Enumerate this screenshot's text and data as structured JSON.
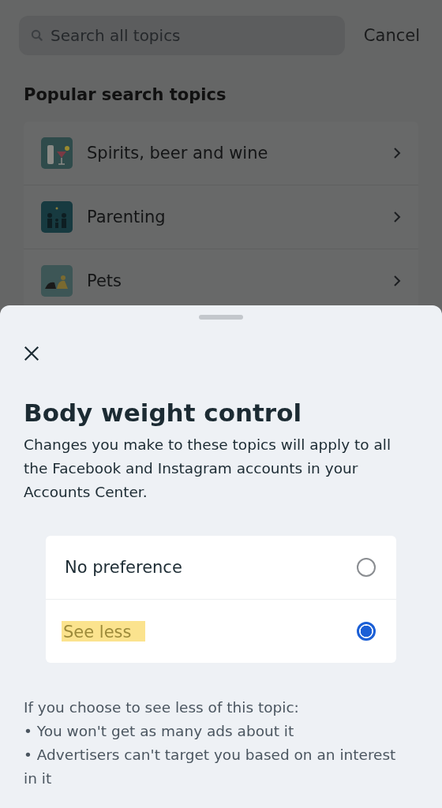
{
  "search": {
    "placeholder": "Search all topics",
    "cancel": "Cancel"
  },
  "section_title": "Popular search topics",
  "topics": [
    {
      "label": "Spirits, beer and wine",
      "kind": "drinks"
    },
    {
      "label": "Parenting",
      "kind": "family"
    },
    {
      "label": "Pets",
      "kind": "pets"
    }
  ],
  "sheet": {
    "title": "Body weight control",
    "description": "Changes you make to these topics will apply to all the Facebook and Instagram accounts in your Accounts Center.",
    "options": [
      {
        "label": "No preference",
        "selected": false,
        "highlighted": false
      },
      {
        "label": "See less",
        "selected": true,
        "highlighted": true
      }
    ],
    "notes": [
      "If you choose to see less of this topic:",
      "• You won't get as many ads about it",
      "• Advertisers can't target you based on an interest in it"
    ]
  }
}
